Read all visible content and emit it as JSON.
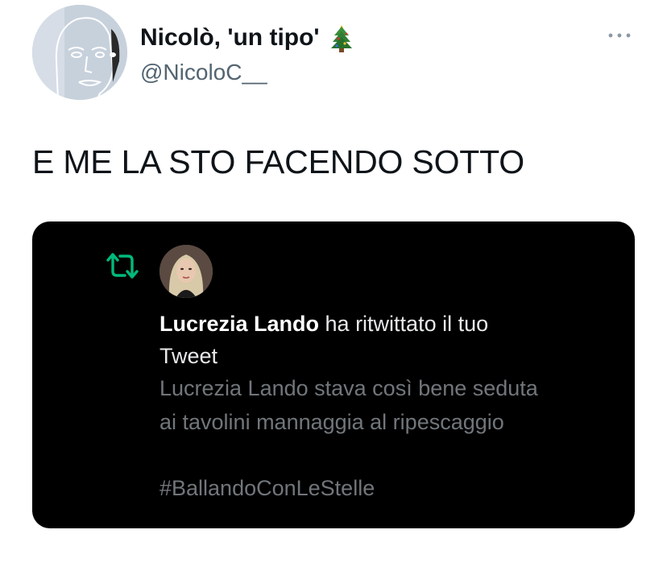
{
  "author": {
    "display_name": "Nicolò, 'un tipo'",
    "handle": "@NicoloC__",
    "avatar_icon": "sketch-face-avatar",
    "name_emoji_icon": "christmas-tree-icon"
  },
  "tweet": {
    "text": "E ME LA STO FACENDO SOTTO"
  },
  "more_icon": "more-options-icon",
  "embedded_notification": {
    "retweet_icon": "retweet-icon",
    "retweet_color": "#00ba7c",
    "background": "#000000",
    "user_name": "Lucrezia Lando",
    "action_text_1": " ha ritwittato il tuo",
    "action_text_2": "Tweet",
    "quoted_line_1": "Lucrezia Lando stava così bene seduta",
    "quoted_line_2": "ai tavolini mannaggia al ripescaggio",
    "quoted_hashtag": "#BallandoConLeStelle"
  }
}
